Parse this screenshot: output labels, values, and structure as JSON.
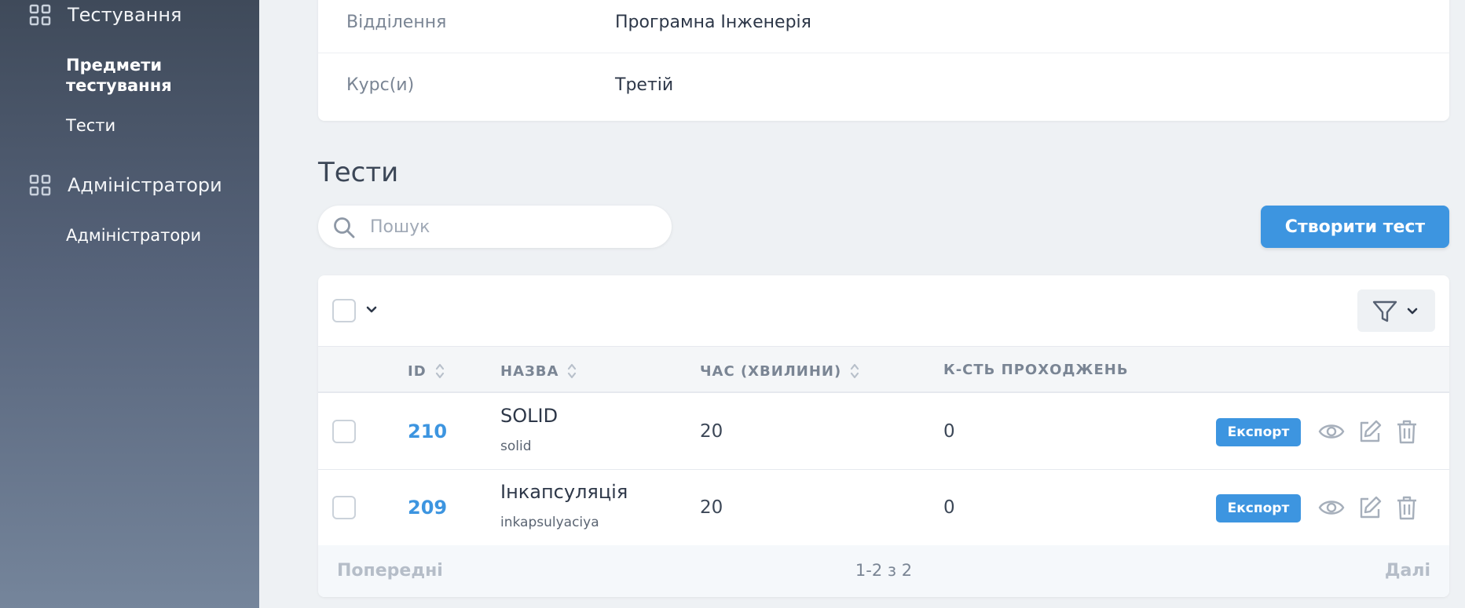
{
  "sidebar": {
    "groups": [
      {
        "label": "Тестування",
        "items": [
          "Предмети тестування",
          "Тести"
        ]
      },
      {
        "label": "Адміністратори",
        "items": [
          "Адміністратори"
        ]
      }
    ]
  },
  "info": {
    "rows": [
      {
        "label": "Відділення",
        "value": "Програмна Інженерія"
      },
      {
        "label": "Курс(и)",
        "value": "Третій"
      }
    ]
  },
  "tests": {
    "title": "Тести",
    "search_placeholder": "Пошук",
    "create_label": "Створити тест",
    "columns": [
      "ID",
      "НАЗВА",
      "ЧАС (ХВИЛИНИ)",
      "К-СТЬ ПРОХОДЖЕНЬ"
    ],
    "rows": [
      {
        "id": "210",
        "name": "SOLID",
        "slug": "solid",
        "time": "20",
        "count": "0",
        "export": "Експорт"
      },
      {
        "id": "209",
        "name": "Інкапсуляція",
        "slug": "inkapsulyaciya",
        "time": "20",
        "count": "0",
        "export": "Експорт"
      }
    ],
    "pager": {
      "prev": "Попередні",
      "info": "1-2 з 2",
      "next": "Далі"
    }
  },
  "colors": {
    "accent": "#3d95e0",
    "sidebar_top": "#3f4a5a",
    "sidebar_bottom": "#75859b"
  }
}
